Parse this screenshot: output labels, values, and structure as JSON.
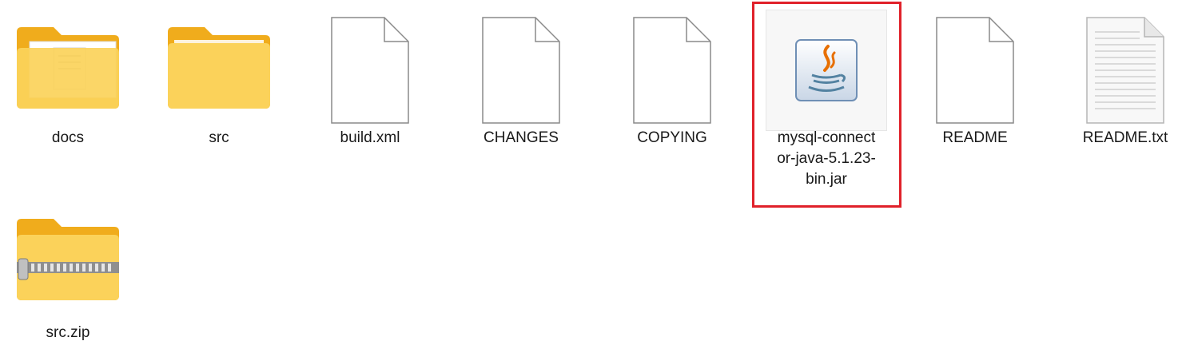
{
  "files": [
    {
      "name": "docs",
      "type": "folder-docs",
      "icon": "folder-with-documents-icon"
    },
    {
      "name": "src",
      "type": "folder",
      "icon": "folder-icon"
    },
    {
      "name": "build.xml",
      "type": "file",
      "icon": "blank-file-icon"
    },
    {
      "name": "CHANGES",
      "type": "file",
      "icon": "blank-file-icon"
    },
    {
      "name": "COPYING",
      "type": "file",
      "icon": "blank-file-icon"
    },
    {
      "name": "mysql-connect\nor-java-5.1.23-\nbin.jar",
      "type": "jar",
      "icon": "java-jar-icon",
      "selected": true
    },
    {
      "name": "README",
      "type": "file",
      "icon": "blank-file-icon"
    },
    {
      "name": "README.txt",
      "type": "text",
      "icon": "text-file-icon"
    },
    {
      "name": "src.zip",
      "type": "zip",
      "icon": "zip-folder-icon"
    }
  ],
  "colors": {
    "folder_back": "#f5b922",
    "folder_front": "#fbd25a",
    "selection_border": "#e0212a",
    "java_orange": "#e76f00",
    "java_blue": "#5382a1"
  }
}
